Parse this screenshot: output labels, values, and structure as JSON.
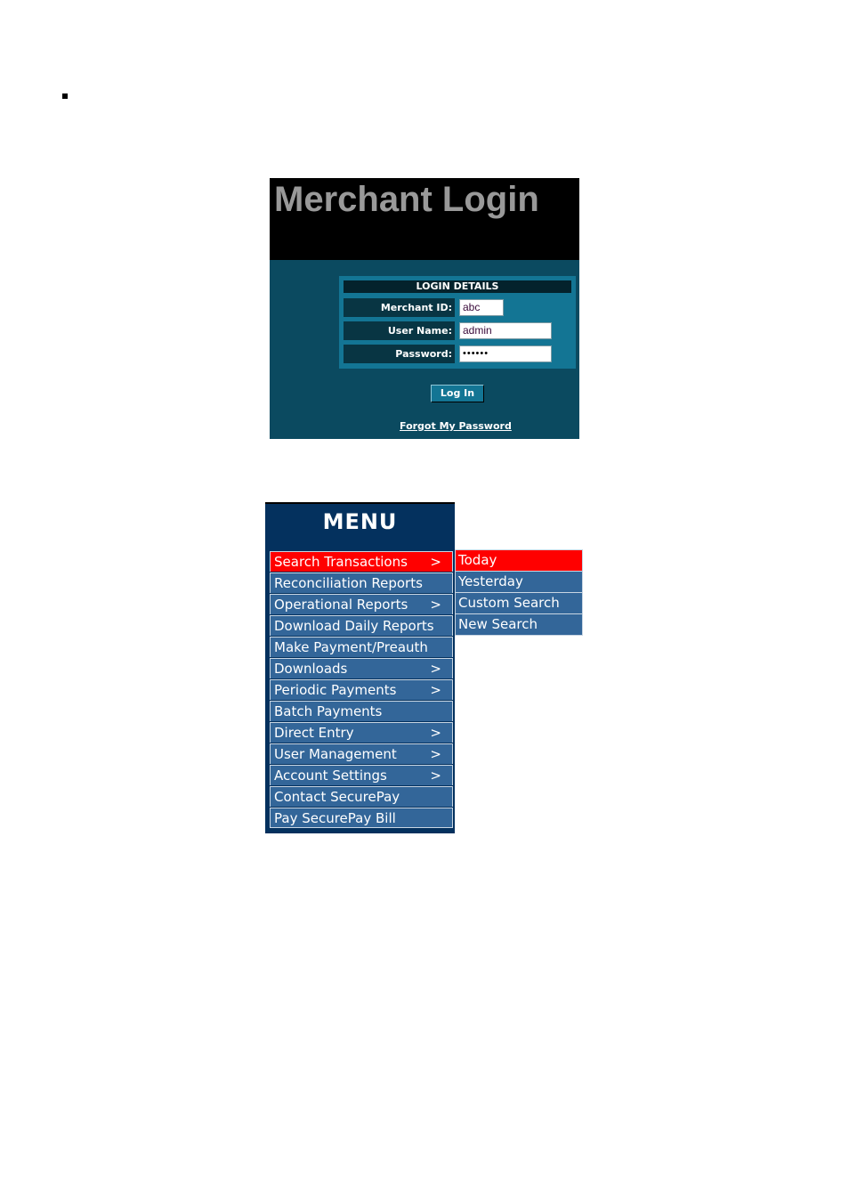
{
  "login": {
    "title": "Merchant Login",
    "section_title": "LOGIN DETAILS",
    "fields": [
      {
        "label": "Merchant ID:",
        "value": "abc"
      },
      {
        "label": "User Name:",
        "value": "admin"
      },
      {
        "label": "Password:",
        "value": "••••••"
      }
    ],
    "login_button": "Log In",
    "forgot_link": "Forgot My Password"
  },
  "menu": {
    "title": "MENU",
    "items": [
      {
        "label": "Search Transactions",
        "arrow": ">"
      },
      {
        "label": "Reconciliation Reports",
        "arrow": ""
      },
      {
        "label": "Operational Reports",
        "arrow": ">"
      },
      {
        "label": "Download Daily Reports",
        "arrow": ""
      },
      {
        "label": "Make Payment/Preauth",
        "arrow": ""
      },
      {
        "label": "Downloads",
        "arrow": ">"
      },
      {
        "label": "Periodic Payments",
        "arrow": ">"
      },
      {
        "label": "Batch Payments",
        "arrow": ""
      },
      {
        "label": "Direct Entry",
        "arrow": ">"
      },
      {
        "label": "User Management",
        "arrow": ">"
      },
      {
        "label": "Account Settings",
        "arrow": ">"
      },
      {
        "label": "Contact SecurePay",
        "arrow": ""
      },
      {
        "label": "Pay SecurePay Bill",
        "arrow": ""
      }
    ],
    "submenu": [
      "Today",
      "Yesterday",
      "Custom Search",
      "New Search"
    ]
  },
  "colors": {
    "highlight": "#ff0000",
    "menu_item": "#336699",
    "menu_bg": "#04315e",
    "login_bg": "#0b4a60"
  }
}
